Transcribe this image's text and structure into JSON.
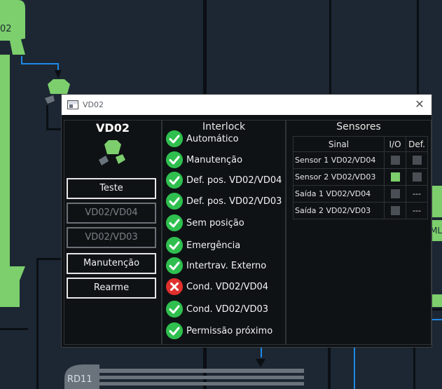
{
  "background": {
    "left_equipment_label": "02",
    "right_equipment_label": "ML",
    "bottom_equipment_label": "RD11"
  },
  "window": {
    "title": "VD02",
    "close_symbol": "✕",
    "title_icon": "window-icon"
  },
  "left_panel": {
    "title": "VD02",
    "valve_icon": "valve-icon",
    "buttons": [
      {
        "label": "Teste",
        "enabled": true
      },
      {
        "label": "VD02/VD04",
        "enabled": false
      },
      {
        "label": "VD02/VD03",
        "enabled": false
      },
      {
        "label": "Manutenção",
        "enabled": true
      },
      {
        "label": "Rearme",
        "enabled": true
      }
    ]
  },
  "interlock": {
    "title": "Interlock",
    "items": [
      {
        "label": "Automático",
        "status": "ok"
      },
      {
        "label": "Manutenção",
        "status": "ok"
      },
      {
        "label": "Def. pos. VD02/VD04",
        "status": "ok"
      },
      {
        "label": "Def. pos. VD02/VD03",
        "status": "ok"
      },
      {
        "label": "Sem posição",
        "status": "ok"
      },
      {
        "label": "Emergência",
        "status": "ok"
      },
      {
        "label": "Intertrav. Externo",
        "status": "ok"
      },
      {
        "label": "Cond. VD02/VD04",
        "status": "fail"
      },
      {
        "label": "Cond. VD02/VD03",
        "status": "ok"
      },
      {
        "label": "Permissão próximo",
        "status": "ok"
      }
    ]
  },
  "sensors": {
    "title": "Sensores",
    "columns": [
      "Sinal",
      "I/O",
      "Def."
    ],
    "rows": [
      {
        "signal": "Sensor 1 VD02/VD04",
        "io": false,
        "def": "box"
      },
      {
        "signal": "Sensor 2 VD02/VD03",
        "io": true,
        "def": "box"
      },
      {
        "signal": "Saída 1 VD02/VD04",
        "io": false,
        "def": "---"
      },
      {
        "signal": "Saída 2 VD02/VD03",
        "io": false,
        "def": "---"
      }
    ]
  },
  "colors": {
    "ok": "#2fbf4f",
    "fail": "#e0302d",
    "io_on": "#7ccf6c",
    "io_off": "#4a4f55",
    "equipment_green": "#7ccf6c"
  }
}
